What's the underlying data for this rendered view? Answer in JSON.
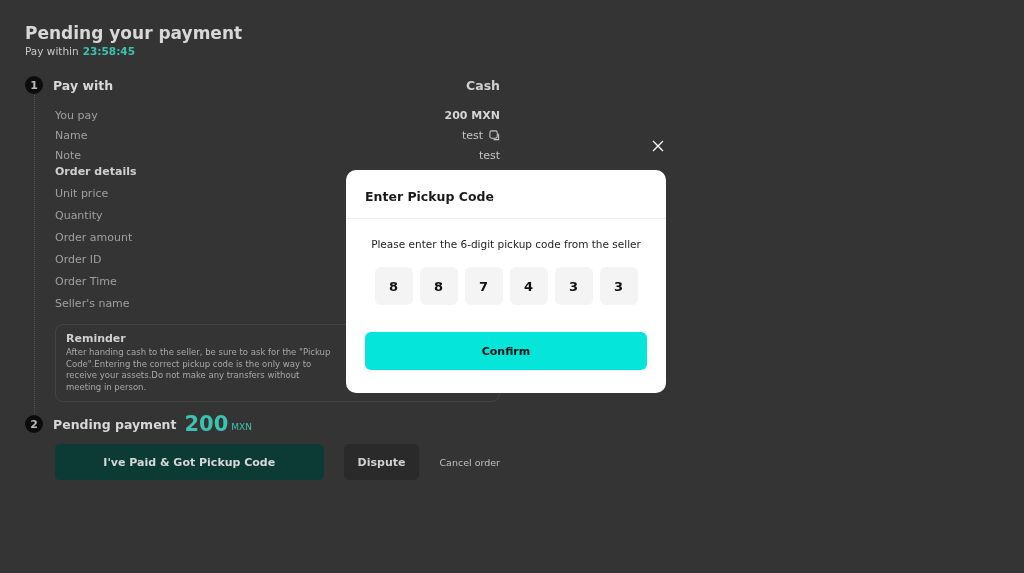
{
  "header": {
    "title": "Pending your payment",
    "timer_label": "Pay within",
    "timer": "23:58:45"
  },
  "step_1": {
    "number": "1",
    "title": "Pay with",
    "method": "Cash",
    "rows": [
      {
        "label": "You pay",
        "value": "200 MXN",
        "kind": "bold"
      },
      {
        "label": "Name",
        "value": "test",
        "kind": "copy"
      },
      {
        "label": "Note",
        "value": "test",
        "kind": "plain"
      }
    ],
    "order_details": {
      "title": "Order details",
      "rows": [
        {
          "label": "Unit price"
        },
        {
          "label": "Quantity"
        },
        {
          "label": "Order amount"
        },
        {
          "label": "Order ID"
        },
        {
          "label": "Order Time"
        },
        {
          "label": "Seller's name"
        }
      ]
    },
    "reminder": {
      "title": "Reminder",
      "text": "After handing cash to the seller, be sure to ask for the \"Pickup Code\".Entering the correct pickup code is the only way to receive your assets.Do not make any transfers without meeting in person."
    }
  },
  "step_2": {
    "number": "2",
    "title": "Pending payment",
    "amount": "200",
    "currency": "MXN",
    "buttons": [
      {
        "label": "I've Paid & Got Pickup Code",
        "kind": "primary"
      },
      {
        "label": "Dispute",
        "kind": "secondary"
      },
      {
        "label": "Cancel order",
        "kind": "link"
      }
    ]
  },
  "dialog": {
    "title": "Enter Pickup Code",
    "message": "Please enter the 6-digit pickup code from the seller",
    "digits": [
      "8",
      "8",
      "7",
      "4",
      "3",
      "3"
    ],
    "confirm": "Confirm"
  }
}
